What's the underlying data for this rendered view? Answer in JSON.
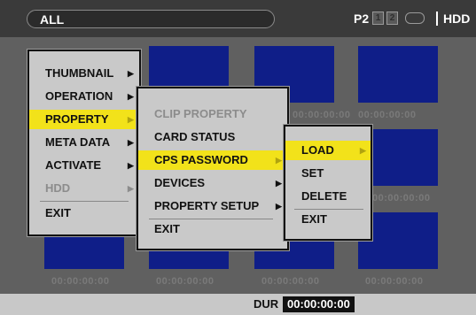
{
  "status_bar": {
    "filter": "ALL",
    "p2_label": "P2",
    "slot1": "1",
    "slot2": "2",
    "hdd_label": "HDD"
  },
  "grid": {
    "timecode": "00:00:00:00"
  },
  "footer": {
    "dur_label": "DUR",
    "dur_value": "00:00:00:00"
  },
  "menu_main": {
    "items": [
      {
        "label": "THUMBNAIL",
        "arrow": "▶"
      },
      {
        "label": "OPERATION",
        "arrow": "▶"
      },
      {
        "label": "PROPERTY",
        "arrow": "▶"
      },
      {
        "label": "META DATA",
        "arrow": "▶"
      },
      {
        "label": "ACTIVATE",
        "arrow": "▶"
      },
      {
        "label": "HDD",
        "arrow": "▶"
      },
      {
        "label": "EXIT"
      }
    ]
  },
  "menu_property": {
    "items": [
      {
        "label": "CLIP PROPERTY"
      },
      {
        "label": "CARD STATUS"
      },
      {
        "label": "CPS PASSWORD",
        "arrow": "▶"
      },
      {
        "label": "DEVICES",
        "arrow": "▶"
      },
      {
        "label": "PROPERTY SETUP",
        "arrow": "▶"
      },
      {
        "label": "EXIT"
      }
    ]
  },
  "menu_cps": {
    "items": [
      {
        "label": "LOAD",
        "arrow": "▶"
      },
      {
        "label": "SET"
      },
      {
        "label": "DELETE"
      },
      {
        "label": "EXIT"
      }
    ]
  },
  "colors": {
    "highlight": "#f2e21a",
    "thumbnail": "#0f1e88",
    "menu_bg": "#c9c9c9"
  }
}
